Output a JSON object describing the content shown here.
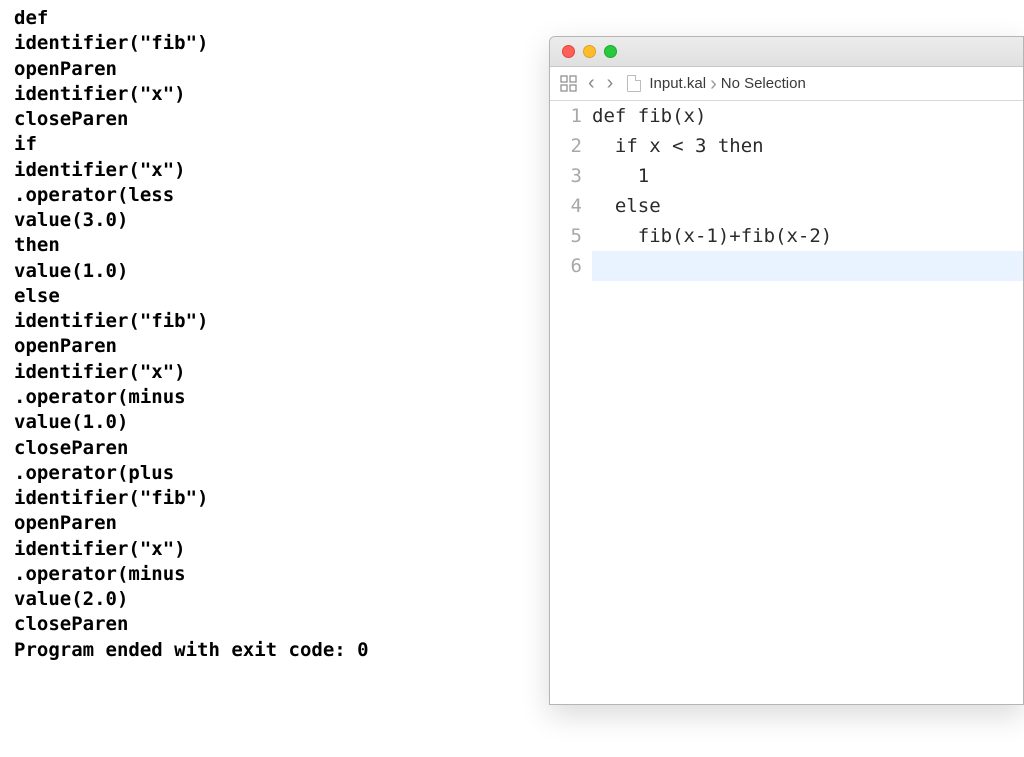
{
  "console": {
    "lines": [
      "def",
      "identifier(\"fib\")",
      "openParen",
      "identifier(\"x\")",
      "closeParen",
      "if",
      "identifier(\"x\")",
      ".operator(less",
      "value(3.0)",
      "then",
      "value(1.0)",
      "else",
      "identifier(\"fib\")",
      "openParen",
      "identifier(\"x\")",
      ".operator(minus",
      "value(1.0)",
      "closeParen",
      ".operator(plus",
      "identifier(\"fib\")",
      "openParen",
      "identifier(\"x\")",
      ".operator(minus",
      "value(2.0)",
      "closeParen",
      "Program ended with exit code: 0"
    ]
  },
  "editor": {
    "breadcrumb": {
      "file": "Input.kal",
      "selection": "No Selection"
    },
    "gutter": [
      "1",
      "2",
      "3",
      "4",
      "5",
      "6"
    ],
    "code": [
      "def fib(x)",
      "  if x < 3 then",
      "    1",
      "  else",
      "    fib(x-1)+fib(x-2)",
      ""
    ],
    "currentLine": 6
  }
}
